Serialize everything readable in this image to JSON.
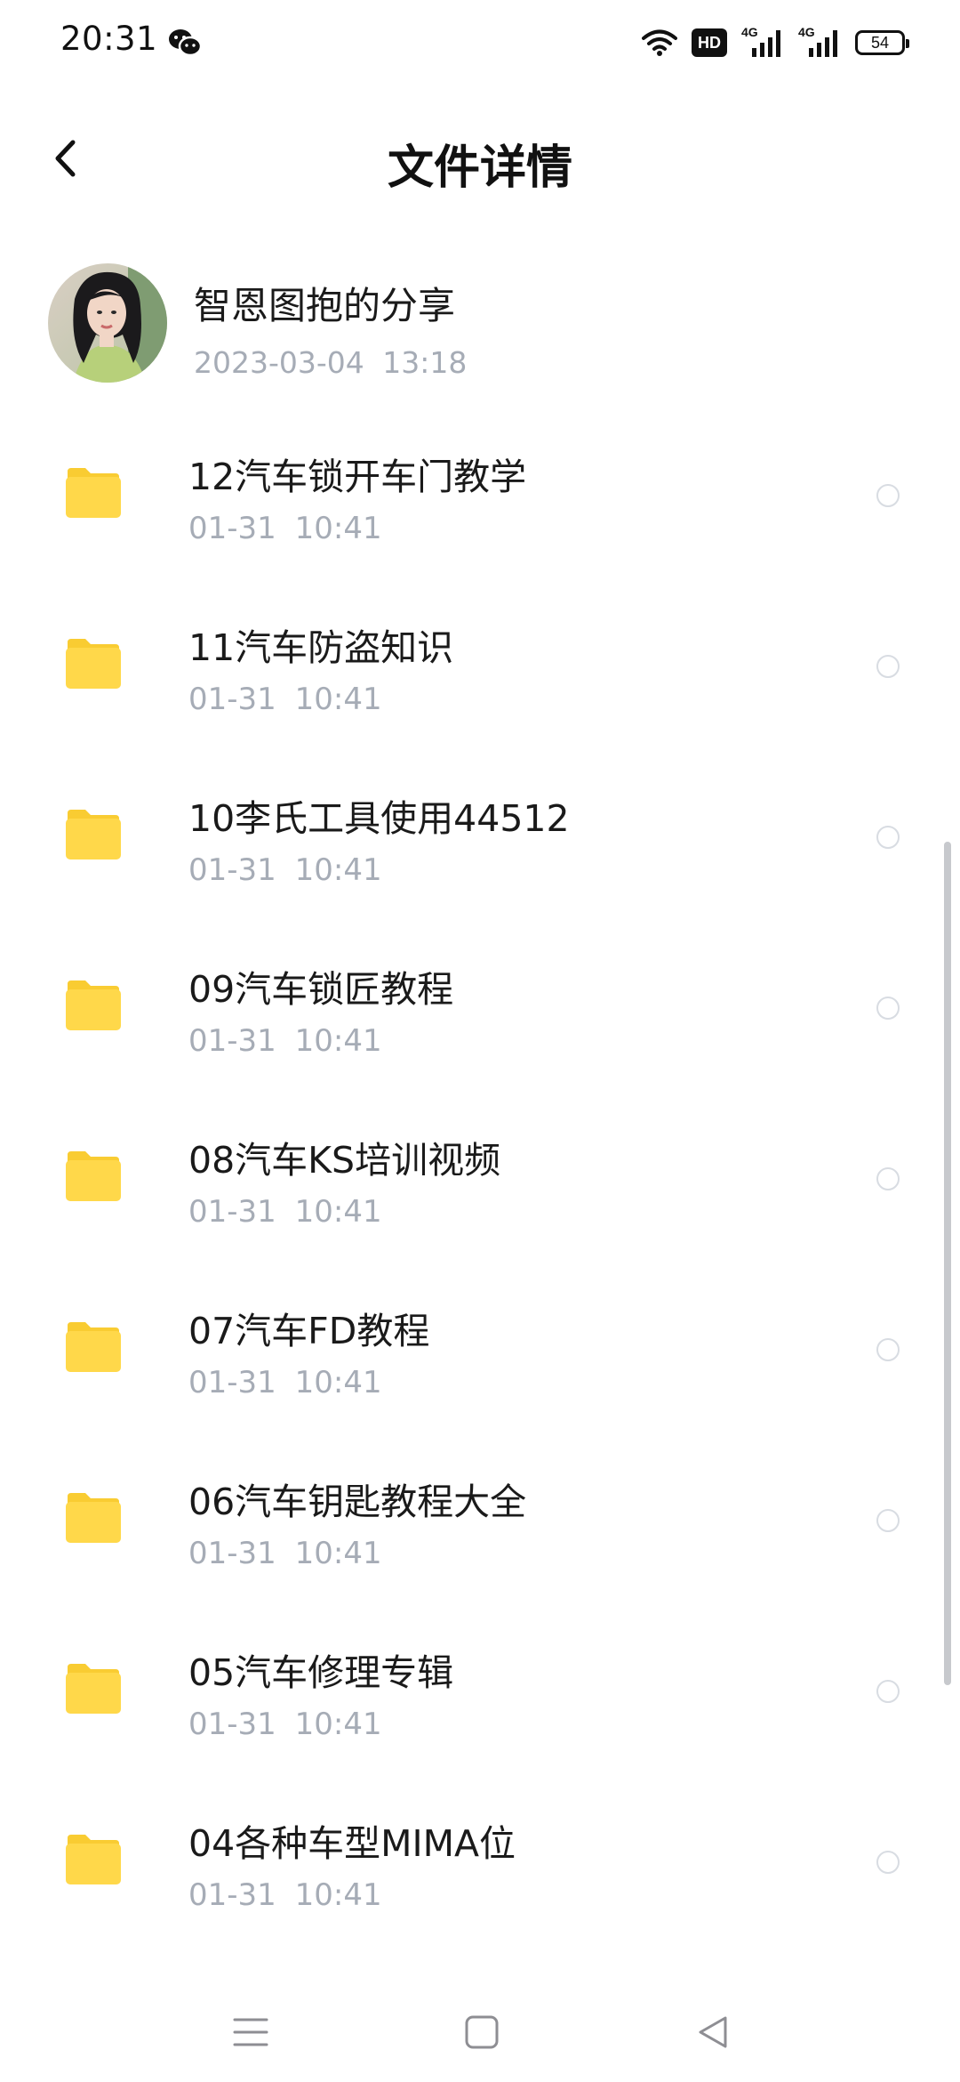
{
  "status_bar": {
    "time": "20:31",
    "app_notification_icon": "wechat-icon",
    "hd_label": "HD",
    "network_1": "4G",
    "network_2": "4G",
    "battery_level": "54"
  },
  "header": {
    "title": "文件详情",
    "back_icon": "chevron-left-icon"
  },
  "sharer": {
    "name": "智恩图抱的分享",
    "datetime": "2023-03-04  13:18"
  },
  "files": [
    {
      "name": "12汽车锁开车门教学",
      "time": "01-31  10:41"
    },
    {
      "name": "11汽车防盗知识",
      "time": "01-31  10:41"
    },
    {
      "name": "10李氏工具使用44512",
      "time": "01-31  10:41"
    },
    {
      "name": "09汽车锁匠教程",
      "time": "01-31  10:41"
    },
    {
      "name": "08汽车KS培训视频",
      "time": "01-31  10:41"
    },
    {
      "name": "07汽车FD教程",
      "time": "01-31  10:41"
    },
    {
      "name": "06汽车钥匙教程大全",
      "time": "01-31  10:41"
    },
    {
      "name": "05汽车修理专辑",
      "time": "01-31  10:41"
    },
    {
      "name": "04各种车型MIMA位",
      "time": "01-31  10:41"
    }
  ],
  "colors": {
    "folder": "#FFD84A",
    "folder_tab": "#F9CC32",
    "secondary_text": "#A6ACB6",
    "primary_text": "#1A1A1A"
  },
  "nav_bar": {
    "menu_icon": "menu-icon",
    "home_icon": "square-home-icon",
    "back_icon": "triangle-back-icon"
  }
}
